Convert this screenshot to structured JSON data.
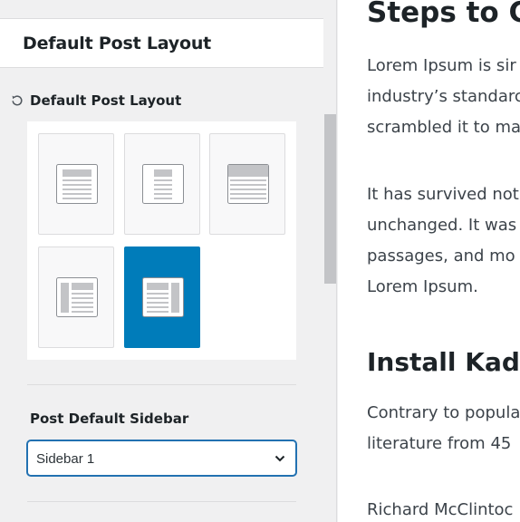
{
  "panel": {
    "section_title": "Default Post Layout",
    "control_label": "Default Post Layout",
    "layout_options": [
      {
        "name": "layout-normal",
        "selected": false
      },
      {
        "name": "layout-narrow",
        "selected": false
      },
      {
        "name": "layout-fullwidth",
        "selected": false
      },
      {
        "name": "layout-left-sidebar",
        "selected": false
      },
      {
        "name": "layout-right-sidebar",
        "selected": true
      }
    ],
    "sidebar_label": "Post Default Sidebar",
    "sidebar_select": {
      "value": "Sidebar 1"
    },
    "colors": {
      "accent": "#007cba",
      "panel_bg": "#f0f0f1"
    }
  },
  "preview": {
    "heading_1": "Steps to Cr",
    "para_1": [
      "Lorem Ipsum is sir",
      "industry’s standarc",
      "scrambled it to ma"
    ],
    "para_2": [
      "It has survived not",
      "unchanged. It was",
      "passages, and mo",
      "Lorem Ipsum."
    ],
    "heading_2": "Install Kaden",
    "para_3": [
      "Contrary to popula",
      "literature from 45"
    ],
    "para_4": [
      "Richard McClintoc"
    ]
  }
}
